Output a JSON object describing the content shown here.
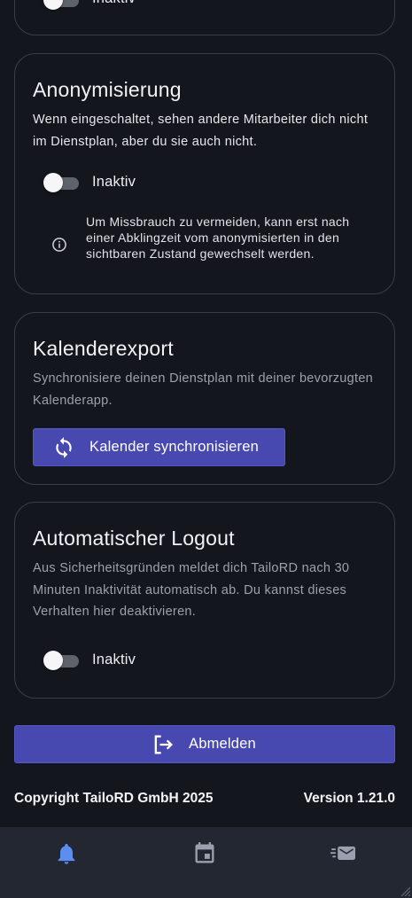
{
  "settings": {
    "top_card": {
      "toggle_label": "Inaktiv"
    },
    "anonymization": {
      "title": "Anonymisierung",
      "description": "Wenn eingeschaltet, sehen andere Mitarbeiter dich nicht im Dienstplan, aber du sie auch nicht.",
      "toggle_label": "Inaktiv",
      "toggle_on": false,
      "info_icon": "info-icon",
      "info_text": "Um Missbrauch zu vermeiden, kann erst nach einer Abklingzeit vom anonymisierten in den sichtbaren Zustand gewechselt werden."
    },
    "calendar_export": {
      "title": "Kalenderexport",
      "description": "Synchronisiere deinen Dienstplan mit deiner bevorzugten Kalenderapp.",
      "button_label": "Kalender synchronisieren",
      "button_icon": "sync-icon"
    },
    "auto_logout": {
      "title": "Automatischer Logout",
      "description": "Aus Sicherheitsgründen meldet dich TailoRD nach 30 Minuten Inaktivität automatisch ab. Du kannst dieses Verhalten hier deaktivieren.",
      "toggle_label": "Inaktiv",
      "toggle_on": false
    }
  },
  "logout_button": {
    "label": "Abmelden",
    "icon": "logout-icon"
  },
  "footer": {
    "copyright": "Copyright TailoRD GmbH 2025",
    "version": "Version 1.21.0"
  },
  "bottom_nav": {
    "items": [
      {
        "icon": "bell-icon",
        "active": true
      },
      {
        "icon": "calendar-icon",
        "active": false
      },
      {
        "icon": "fast-mail-icon",
        "active": false
      }
    ]
  },
  "colors": {
    "background": "#13161c",
    "card_border": "#3a3e47",
    "accent_button": "#4849b0",
    "nav_background": "#232731",
    "nav_active": "#5b8ef0",
    "nav_inactive": "#9aa0ad",
    "muted_text": "#9da1aa"
  }
}
